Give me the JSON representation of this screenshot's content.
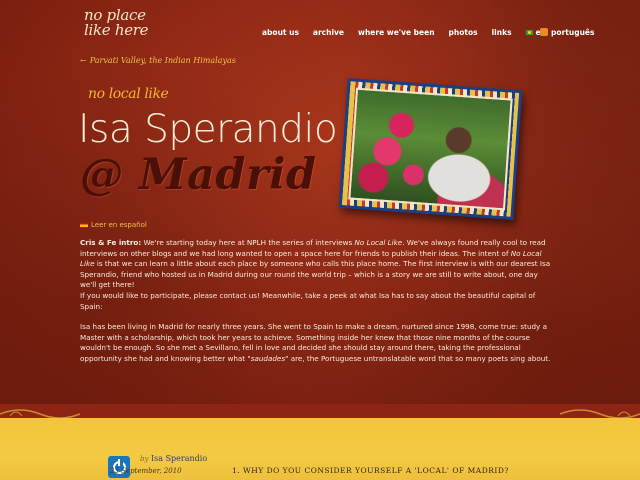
{
  "site": {
    "logo_line1": "no place",
    "logo_line2": "like here"
  },
  "nav": {
    "items": [
      {
        "label": "about us"
      },
      {
        "label": "archive"
      },
      {
        "label": "where we've been"
      },
      {
        "label": "photos"
      },
      {
        "label": "links"
      },
      {
        "label": "em português",
        "icon": "brazil-flag-icon"
      }
    ],
    "rss_icon": "rss-icon"
  },
  "back_link": {
    "arrow": "←",
    "label": "Parvati Valley, the Indian Himalayas"
  },
  "post": {
    "series": "no local like",
    "name": "Isa Sperandio",
    "city": "@ Madrid",
    "leer_label": "Leer en español",
    "intro_label": "Cris & Fe intro:",
    "intro_text_1": " We're starting today here at NPLH the series of interviews ",
    "intro_em_1": "No Local Like",
    "intro_text_2": ". We've always found really cool to read interviews on other blogs and we had long wanted to open a space here for friends to publish their ideas. The intent of ",
    "intro_em_2": "No Local Like",
    "intro_text_3": " is that we can learn a little about each place by someone who calls this place home. The first interview is with our dearest Isa Sperandio, friend who hosted us in Madrid during our round the world trip – which is a story we are still to write about, one day we'll get there!",
    "intro_text_4": "If you would like to participate, please contact us! Meanwhile, take a peek at what Isa has to say about the beautiful capital of Spain:",
    "para2_text_1": "Isa has been living in Madrid for nearly three years. She went to Spain to make a dream, nurtured since 1998, come true: study a Master with a scholarship, which took her years to achieve. Something inside her knew that those nine months of the course wouldn't be enough. So she met a Sevillano, fell in love and decided she should stay around there, taking the professional opportunity she had and knowing better what \"",
    "para2_em": "saudades",
    "para2_text_2": "\" are, the Portuguese untranslatable word that so many poets sing about."
  },
  "author": {
    "by": "by",
    "name": "Isa Sperandio",
    "date": "23 September, 2010"
  },
  "question": "1. WHY DO YOU CONSIDER YOURSELF A 'LOCAL' OF MADRID?",
  "colors": {
    "background": "#8e2414",
    "accent_yellow": "#f0c24a",
    "city_text": "#4a1008",
    "bottom_yellow": "#f2c43a"
  }
}
